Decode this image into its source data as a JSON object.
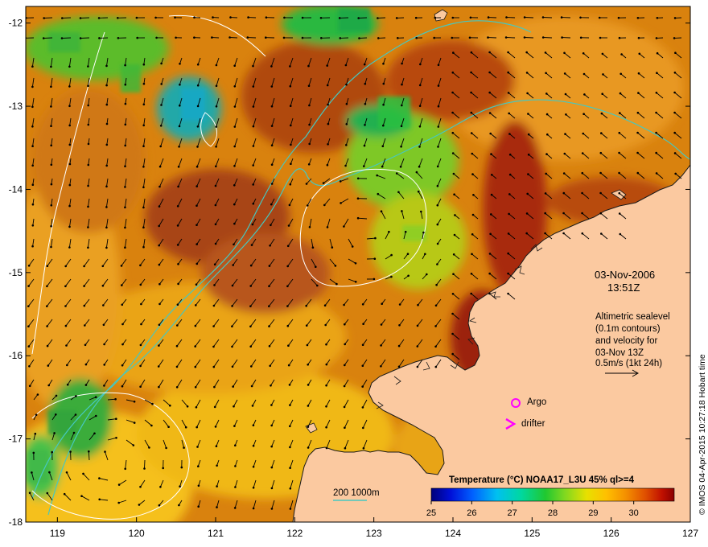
{
  "map": {
    "x_ticks": [
      "119",
      "120",
      "121",
      "122",
      "123",
      "124",
      "125",
      "126",
      "127"
    ],
    "y_ticks": [
      "-12",
      "-13",
      "-14",
      "-15",
      "-16",
      "-17",
      "-18"
    ],
    "lon_range": [
      118.6,
      127.0
    ],
    "lat_range": [
      -18.0,
      -11.8
    ]
  },
  "annotations": {
    "date": "03-Nov-2006",
    "time": "13:51Z",
    "altimetry_lines": [
      "Altimetric sealevel",
      "(0.1m contours)",
      "and velocity for",
      "03-Nov 13Z",
      "0.5m/s (1kt 24h)"
    ],
    "argo_label": "Argo",
    "drifter_label": "drifter",
    "depth_label": "200  1000m"
  },
  "colorbar": {
    "title": "Temperature (°C) NOAA17_L3U 45% ql>=4",
    "ticks": [
      "25",
      "26",
      "27",
      "28",
      "29",
      "30"
    ],
    "range": [
      25,
      31
    ]
  },
  "credit": "© IMOS 04-Apr-2015 10:27:18 Hobart time",
  "colors": {
    "land": "#fbc9a0",
    "isobath": "#46c8c0",
    "contour": "#ffffff",
    "argo": "#ff00ff",
    "drifter": "#ff00ff"
  }
}
